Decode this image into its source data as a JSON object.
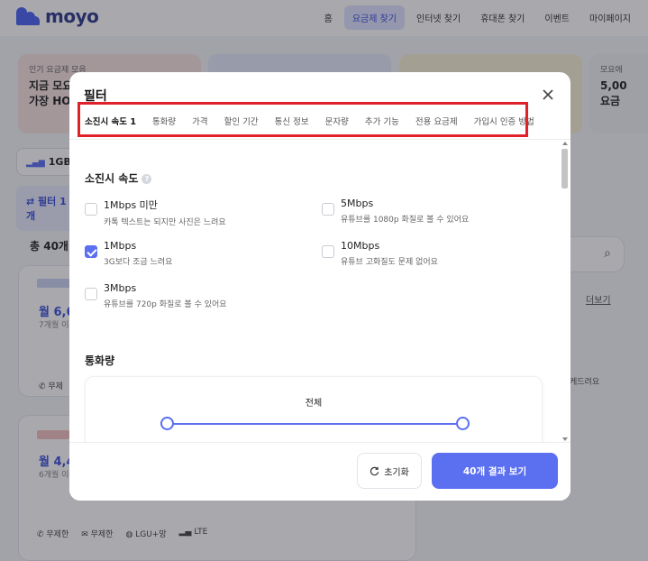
{
  "header": {
    "logo_text": "moyo",
    "nav": [
      "홈",
      "요금제 찾기",
      "인터넷 찾기",
      "휴대폰 찾기",
      "이벤트",
      "마이페이지"
    ],
    "active_nav_index": 1
  },
  "background": {
    "banner1_small": "인기 요금제 모음",
    "banner1_text_line1": "지금 모요",
    "banner1_text_line2": "가장 HO",
    "banner4_small": "모요에",
    "banner4_text_line1": "5,00",
    "banner4_text_line2": "요금",
    "chip_data": "1GB",
    "chip_filter": "필터 1개",
    "total_count": "총 40개",
    "card1_price": "월 6,6",
    "card1_sub": "7개월 이후",
    "card1_feature": "무제",
    "card2_price": "월 4,4",
    "card2_sub": "6개월 이후",
    "card2_feature": "무제",
    "more_link": "더보기",
    "side_text": "케드려요",
    "bottom_specs": [
      "무제한",
      "무제한",
      "LGU+망",
      "LTE"
    ]
  },
  "modal": {
    "title": "필터",
    "tabs": [
      "소진시 속도 1",
      "통화량",
      "가격",
      "할인 기간",
      "통신 정보",
      "문자량",
      "추가 기능",
      "전용 요금제",
      "가입시 인증 방법"
    ],
    "active_tab_index": 0,
    "speed_section_title": "소진시 속도",
    "help_icon_glyph": "?",
    "options": [
      {
        "label": "1Mbps 미만",
        "desc": "카톡 텍스트는 되지만 사진은 느려요",
        "checked": false
      },
      {
        "label": "5Mbps",
        "desc": "유튜브를 1080p 화질로 볼 수 있어요",
        "checked": false
      },
      {
        "label": "1Mbps",
        "desc": "3G보다 조금 느려요",
        "checked": true
      },
      {
        "label": "10Mbps",
        "desc": "유튜브 고화질도 문제 없어요",
        "checked": false
      },
      {
        "label": "3Mbps",
        "desc": "유튜브를 720p 화질로 볼 수 있어요",
        "checked": false
      }
    ],
    "call_section_title": "통화량",
    "call_range_label": "전체",
    "reset_label": "초기화",
    "results_label": "40개 결과 보기",
    "accent_color": "#5b6ff1",
    "highlight_color": "#e0212a"
  }
}
